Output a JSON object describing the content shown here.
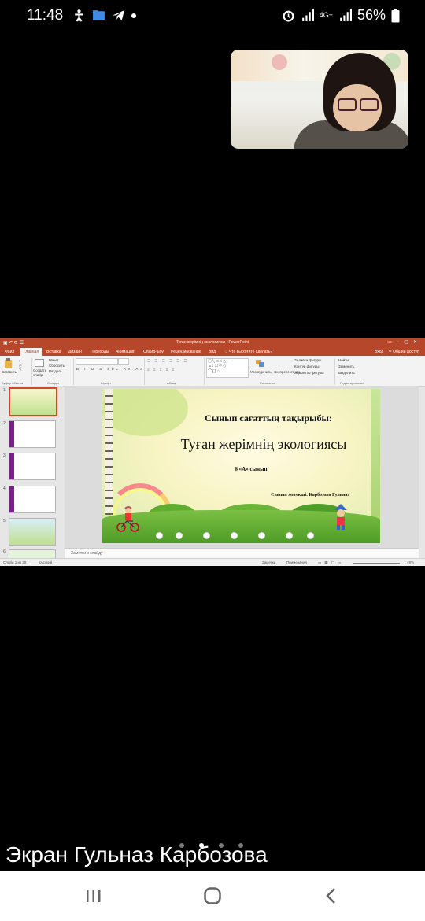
{
  "status_bar": {
    "time": "11:48",
    "network": "4G+",
    "battery": "56%"
  },
  "powerpoint": {
    "window_title": "Туған жерімнің экологиясы - PowerPoint",
    "tabs": [
      "Файл",
      "Главная",
      "Вставка",
      "Дизайн",
      "Переходы",
      "Анимация",
      "Слайд-шоу",
      "Рецензирование",
      "Вид"
    ],
    "tell_me": "Что вы хотите сделать?",
    "sign_in": "Вход",
    "share": "Общий доступ",
    "ribbon": {
      "paste": "Вставить",
      "create_slide": "Создать слайд",
      "layout": "Макет",
      "reset": "Сбросить",
      "section": "Раздел",
      "arrange": "Упорядочить",
      "quick_styles": "Экспресс-стили",
      "shape_fill": "Заливка фигуры",
      "shape_outline": "Контур фигуры",
      "shape_effects": "Эффекты фигуры",
      "find": "Найти",
      "replace": "Заменить",
      "select": "Выделить",
      "groups": {
        "clipboard": "Буфер обмена",
        "slides": "Слайды",
        "font": "Шрифт",
        "paragraph": "Абзац",
        "drawing": "Рисование",
        "editing": "Редактирование"
      }
    },
    "thumb_numbers": [
      "1",
      "2",
      "3",
      "4",
      "5",
      "6"
    ],
    "slide": {
      "heading": "Сынып сағаттың тақырыбы:",
      "title": "Туған жерімнің экологиясы",
      "class": "6 «А» сынып",
      "teacher": "Сынып жетекші: Карбозова Гульназ"
    },
    "notes_placeholder": "Заметки к слайду",
    "status": {
      "slide_counter": "Слайд 1 из 28",
      "language": "русский",
      "notes_btn": "Заметки",
      "comments_btn": "Примечания",
      "zoom": "49%"
    }
  },
  "screen_share_label": "Экран Гульназ Карбозова",
  "nav": {
    "recent": "recent-apps-icon",
    "home": "home-icon",
    "back": "back-icon"
  }
}
